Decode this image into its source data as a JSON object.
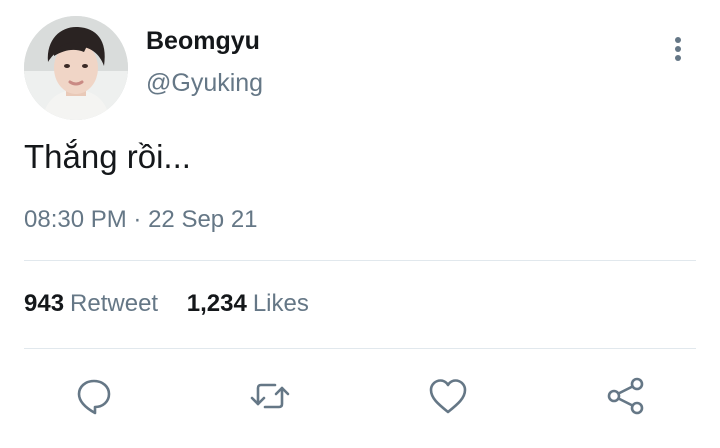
{
  "user": {
    "display_name": "Beomgyu",
    "handle": "@Gyuking"
  },
  "tweet": {
    "text": "Thắng rồi...",
    "time": "08:30 PM",
    "separator": "·",
    "date": "22 Sep 21"
  },
  "stats": {
    "retweets_count": "943",
    "retweets_label": "Retweet",
    "likes_count": "1,234",
    "likes_label": "Likes"
  },
  "actions": [
    {
      "name": "reply",
      "icon": "speech-bubble-icon"
    },
    {
      "name": "retweet",
      "icon": "retweet-arrows-icon"
    },
    {
      "name": "like",
      "icon": "heart-icon"
    },
    {
      "name": "share",
      "icon": "share-nodes-icon"
    }
  ],
  "colors": {
    "text_primary": "#14171a",
    "text_secondary": "#657786",
    "divider": "#e1e8ed",
    "background": "#ffffff"
  }
}
